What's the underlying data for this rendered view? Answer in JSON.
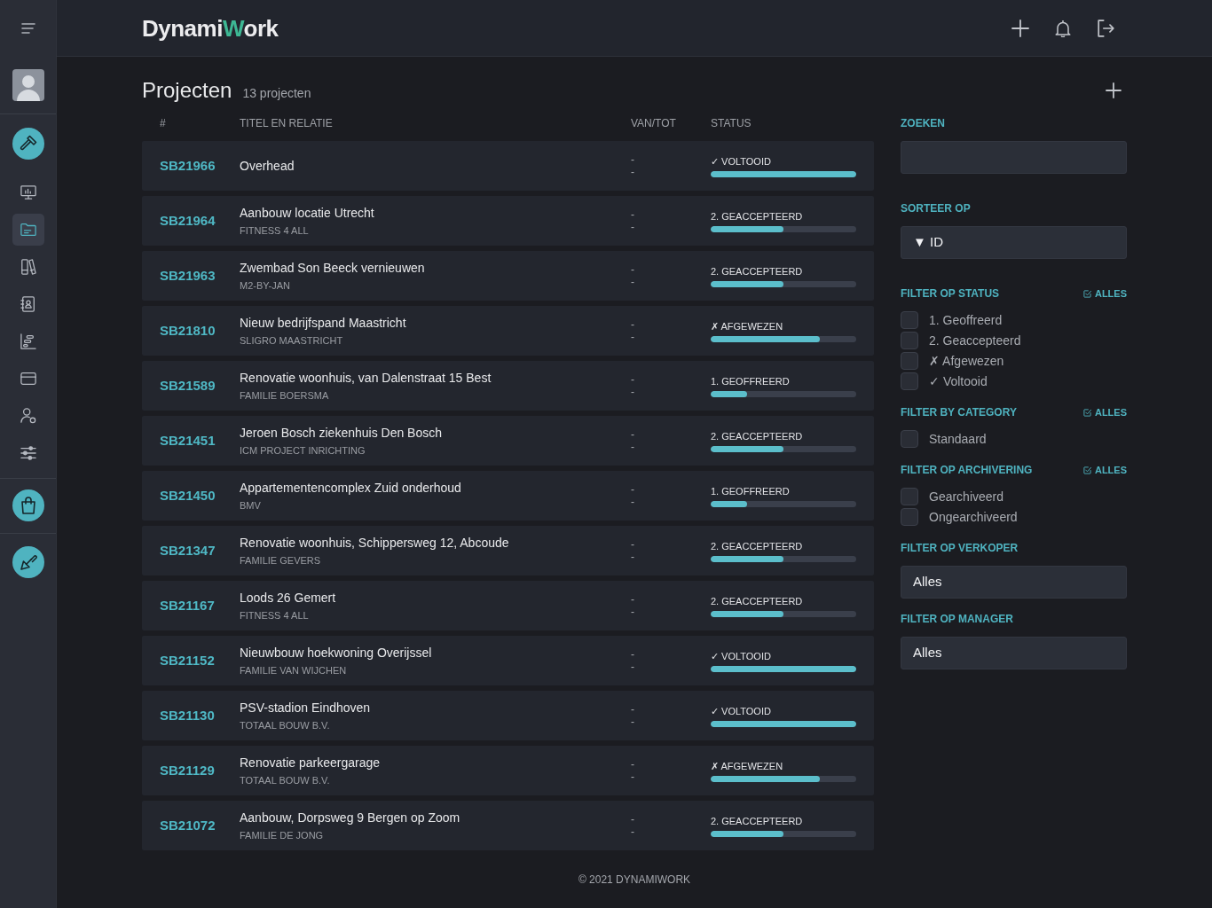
{
  "header": {
    "logo": [
      {
        "text": "Dynami",
        "accent": false
      },
      {
        "text": "W",
        "accent": true
      },
      {
        "text": "ork",
        "accent": false
      }
    ]
  },
  "sidebar": {
    "items": [
      {
        "kind": "action",
        "selected": false
      },
      {
        "kind": "nav",
        "selected": false
      },
      {
        "kind": "nav",
        "selected": true
      },
      {
        "kind": "nav",
        "selected": false
      },
      {
        "kind": "nav",
        "selected": false
      },
      {
        "kind": "nav",
        "selected": false
      },
      {
        "kind": "nav",
        "selected": false
      },
      {
        "kind": "nav",
        "selected": false
      },
      {
        "kind": "nav",
        "selected": false
      },
      {
        "kind": "action",
        "selected": false
      },
      {
        "kind": "action",
        "selected": false
      }
    ]
  },
  "page": {
    "title": "Projecten",
    "count": "13 projecten"
  },
  "table": {
    "columns": [
      "#",
      "TITEL EN RELATIE",
      "VAN/TOT",
      "STATUS"
    ],
    "rows": [
      {
        "id": "SB21966",
        "title": "Overhead",
        "from": "-",
        "to": "-",
        "status": "✓ VOLTOOID",
        "level": 1
      },
      {
        "id": "SB21964",
        "title": "Aanbouw locatie Utrecht",
        "relation": "FITNESS 4 ALL",
        "from": "-",
        "to": "-",
        "status": "2. GEACCEPTEERD",
        "level": 0.5
      },
      {
        "id": "SB21963",
        "title": "Zwembad Son Beeck vernieuwen",
        "relation": "M2-BY-JAN",
        "from": "-",
        "to": "-",
        "status": "2. GEACCEPTEERD",
        "level": 0.5
      },
      {
        "id": "SB21810",
        "title": "Nieuw bedrijfspand Maastricht",
        "relation": "SLIGRO MAASTRICHT",
        "from": "-",
        "to": "-",
        "status": "✗ AFGEWEZEN",
        "level": 0.75
      },
      {
        "id": "SB21589",
        "title": "Renovatie woonhuis, van Dalenstraat 15 Best",
        "relation": "FAMILIE BOERSMA",
        "from": "-",
        "to": "-",
        "status": "1. GEOFFREERD",
        "level": 0.25
      },
      {
        "id": "SB21451",
        "title": "Jeroen Bosch ziekenhuis Den Bosch",
        "relation": "ICM PROJECT INRICHTING",
        "from": "-",
        "to": "-",
        "status": "2. GEACCEPTEERD",
        "level": 0.5
      },
      {
        "id": "SB21450",
        "title": "Appartementencomplex Zuid onderhoud",
        "relation": "BMV",
        "from": "-",
        "to": "-",
        "status": "1. GEOFFREERD",
        "level": 0.25
      },
      {
        "id": "SB21347",
        "title": "Renovatie woonhuis, Schippersweg 12, Abcoude",
        "relation": "FAMILIE GEVERS",
        "from": "-",
        "to": "-",
        "status": "2. GEACCEPTEERD",
        "level": 0.5
      },
      {
        "id": "SB21167",
        "title": "Loods 26 Gemert",
        "relation": "FITNESS 4 ALL",
        "from": "-",
        "to": "-",
        "status": "2. GEACCEPTEERD",
        "level": 0.5
      },
      {
        "id": "SB21152",
        "title": "Nieuwbouw hoekwoning Overijssel",
        "relation": "FAMILIE VAN WIJCHEN",
        "from": "-",
        "to": "-",
        "status": "✓ VOLTOOID",
        "level": 1
      },
      {
        "id": "SB21130",
        "title": "PSV-stadion Eindhoven",
        "relation": "TOTAAL BOUW B.V.",
        "from": "-",
        "to": "-",
        "status": "✓ VOLTOOID",
        "level": 1
      },
      {
        "id": "SB21129",
        "title": "Renovatie parkeergarage",
        "relation": "TOTAAL BOUW B.V.",
        "from": "-",
        "to": "-",
        "status": "✗ AFGEWEZEN",
        "level": 0.75
      },
      {
        "id": "SB21072",
        "title": "Aanbouw, Dorpsweg 9 Bergen op Zoom",
        "relation": "FAMILIE DE JONG",
        "from": "-",
        "to": "-",
        "status": "2. GEACCEPTEERD",
        "level": 0.5
      }
    ]
  },
  "filters": [
    {
      "kind": "search",
      "title": "ZOEKEN"
    },
    {
      "kind": "sort",
      "title": "SORTEER OP",
      "value": "▼ ID"
    },
    {
      "kind": "checklist",
      "title": "FILTER OP STATUS",
      "all_label": "ALLES",
      "options": [
        {
          "label": "1. Geoffreerd",
          "checked": false
        },
        {
          "label": "2. Geaccepteerd",
          "checked": false
        },
        {
          "label": "✗ Afgewezen",
          "checked": false
        },
        {
          "label": "✓ Voltooid",
          "checked": false
        }
      ]
    },
    {
      "kind": "checklist",
      "title": "FILTER BY CATEGORY",
      "all_label": "ALLES",
      "options": [
        {
          "label": "Standaard",
          "checked": false
        }
      ]
    },
    {
      "kind": "checklist",
      "title": "FILTER OP ARCHIVERING",
      "all_label": "ALLES",
      "options": [
        {
          "label": "Gearchiveerd",
          "checked": false
        },
        {
          "label": "Ongearchiveerd",
          "checked": false
        }
      ]
    },
    {
      "kind": "select",
      "title": "FILTER OP VERKOPER",
      "value": "Alles"
    },
    {
      "kind": "select",
      "title": "FILTER OP MANAGER",
      "value": "Alles"
    }
  ],
  "footer": "© 2021 DYNAMIWORK"
}
